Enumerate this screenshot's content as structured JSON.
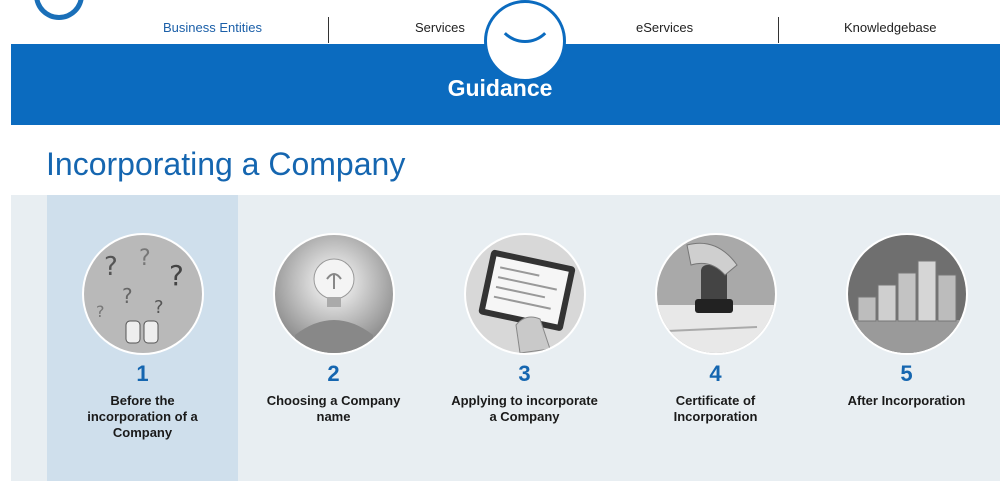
{
  "nav": {
    "items": [
      {
        "label": "Business Entities",
        "active": true
      },
      {
        "label": "Services",
        "active": false
      },
      {
        "label": "eServices",
        "active": false
      },
      {
        "label": "Knowledgebase",
        "active": false
      }
    ]
  },
  "hero": {
    "title": "Guidance"
  },
  "page": {
    "title": "Incorporating a Company"
  },
  "steps": [
    {
      "number": "1",
      "label": "Before the incorporation of a Company",
      "active": true,
      "image": "question-marks-icon"
    },
    {
      "number": "2",
      "label": "Choosing a Company name",
      "active": false,
      "image": "lightbulb-icon"
    },
    {
      "number": "3",
      "label": "Applying to incorporate a Company",
      "active": false,
      "image": "tablet-form-icon"
    },
    {
      "number": "4",
      "label": "Certificate of Incorporation",
      "active": false,
      "image": "stamp-icon"
    },
    {
      "number": "5",
      "label": "After Incorporation",
      "active": false,
      "image": "wooden-blocks-icon"
    }
  ],
  "colors": {
    "brand": "#0b6bbf",
    "title": "#1566b0",
    "panel": "#e8eef2",
    "active_step": "#cfdfec"
  }
}
